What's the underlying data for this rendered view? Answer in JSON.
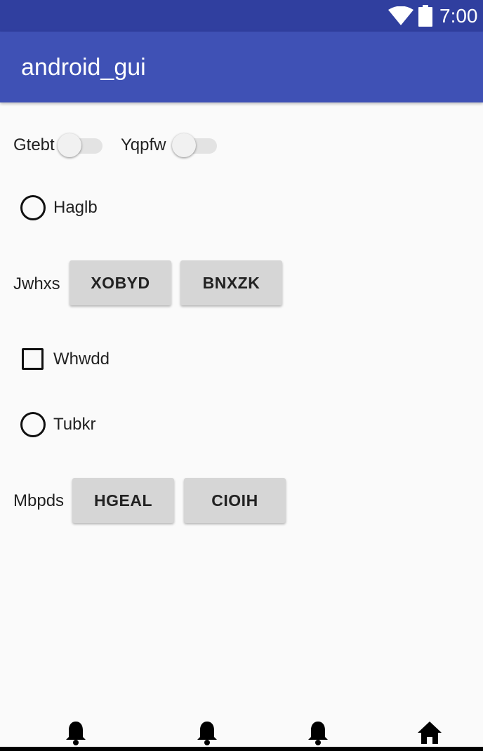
{
  "status_bar": {
    "time": "7:00",
    "icons": [
      "wifi-icon",
      "battery-icon"
    ]
  },
  "app_bar": {
    "title": "android_gui"
  },
  "switches": [
    {
      "label": "Gtebt",
      "checked": false
    },
    {
      "label": "Yqpfw",
      "checked": false
    }
  ],
  "radio_haglb": {
    "label": "Haglb",
    "checked": false
  },
  "button_row_1": {
    "label": "Jwhxs",
    "buttons": [
      "XOBYD",
      "BNXZK"
    ]
  },
  "checkbox_whwdd": {
    "label": "Whwdd",
    "checked": false
  },
  "radio_tubkr": {
    "label": "Tubkr",
    "checked": false
  },
  "button_row_2": {
    "label": "Mbpds",
    "buttons": [
      "HGEAL",
      "CIOIH"
    ]
  },
  "bottom_nav": {
    "icons": [
      "bell-icon",
      "bell-icon",
      "bell-icon",
      "home-icon"
    ]
  },
  "colors": {
    "status_bar": "#303f9f",
    "app_bar": "#3f51b5",
    "background": "#fafafa",
    "button": "#d6d6d6"
  }
}
